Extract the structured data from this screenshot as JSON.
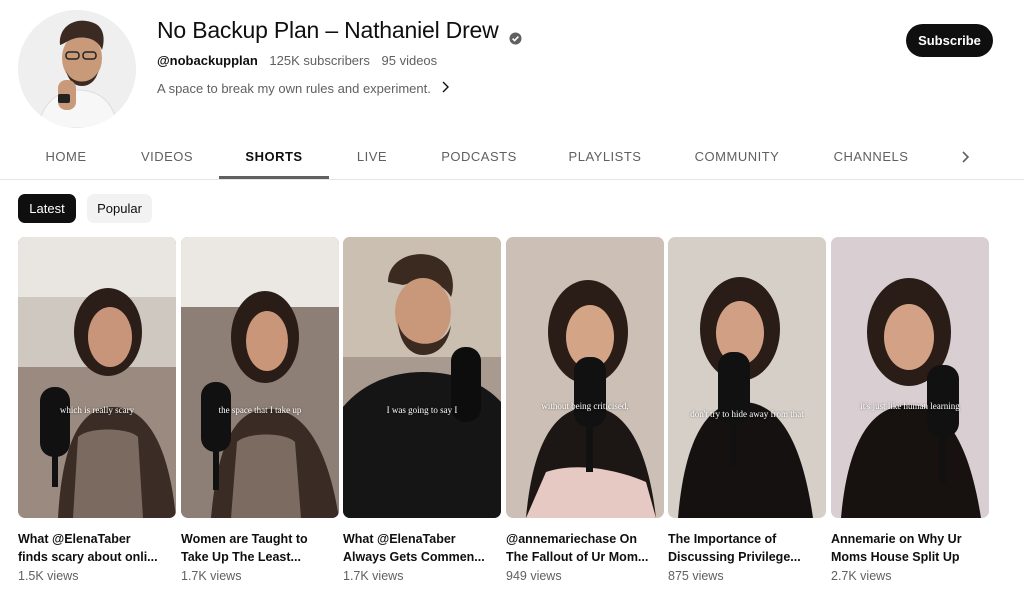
{
  "channel": {
    "name": "No Backup Plan – Nathaniel Drew",
    "handle": "@nobackupplan",
    "subscribers": "125K subscribers",
    "videos": "95 videos",
    "description": "A space to break my own rules and experiment.",
    "subscribe_label": "Subscribe"
  },
  "tabs": [
    {
      "label": "HOME"
    },
    {
      "label": "VIDEOS"
    },
    {
      "label": "SHORTS"
    },
    {
      "label": "LIVE"
    },
    {
      "label": "PODCASTS"
    },
    {
      "label": "PLAYLISTS"
    },
    {
      "label": "COMMUNITY"
    },
    {
      "label": "CHANNELS"
    }
  ],
  "active_tab": "SHORTS",
  "chips": [
    {
      "label": "Latest"
    },
    {
      "label": "Popular"
    }
  ],
  "shorts": [
    {
      "line1": "What @ElenaTaber",
      "line2": "finds scary about onli...",
      "views": "1.5K views",
      "caption": "which is really scary"
    },
    {
      "line1": "Women are Taught to",
      "line2": "Take Up The Least...",
      "views": "1.7K views",
      "caption": "the space that I take up"
    },
    {
      "line1": "What @ElenaTaber",
      "line2": "Always Gets Commen...",
      "views": "1.7K views",
      "caption": "I was going to say I"
    },
    {
      "line1": "@annemariechase On",
      "line2": "The Fallout of Ur Mom...",
      "views": "949 views",
      "caption": "without being criticised,"
    },
    {
      "line1": "The Importance of",
      "line2": "Discussing Privilege...",
      "views": "875 views",
      "caption": "don't try to hide away from that"
    },
    {
      "line1": "Annemarie on Why Ur",
      "line2": "Moms House Split Up",
      "views": "2.7K views",
      "caption": "it's just like human learning"
    }
  ],
  "icons": {
    "verified": "verified-check-icon",
    "description_more": "chevron-right-icon",
    "tabs_next": "chevron-right-icon"
  },
  "colors": {
    "subscribe_bg": "#0f0f0f",
    "chip_selected_bg": "#0f0f0f",
    "chip_bg": "#f2f2f2",
    "secondary_text": "#606060"
  }
}
